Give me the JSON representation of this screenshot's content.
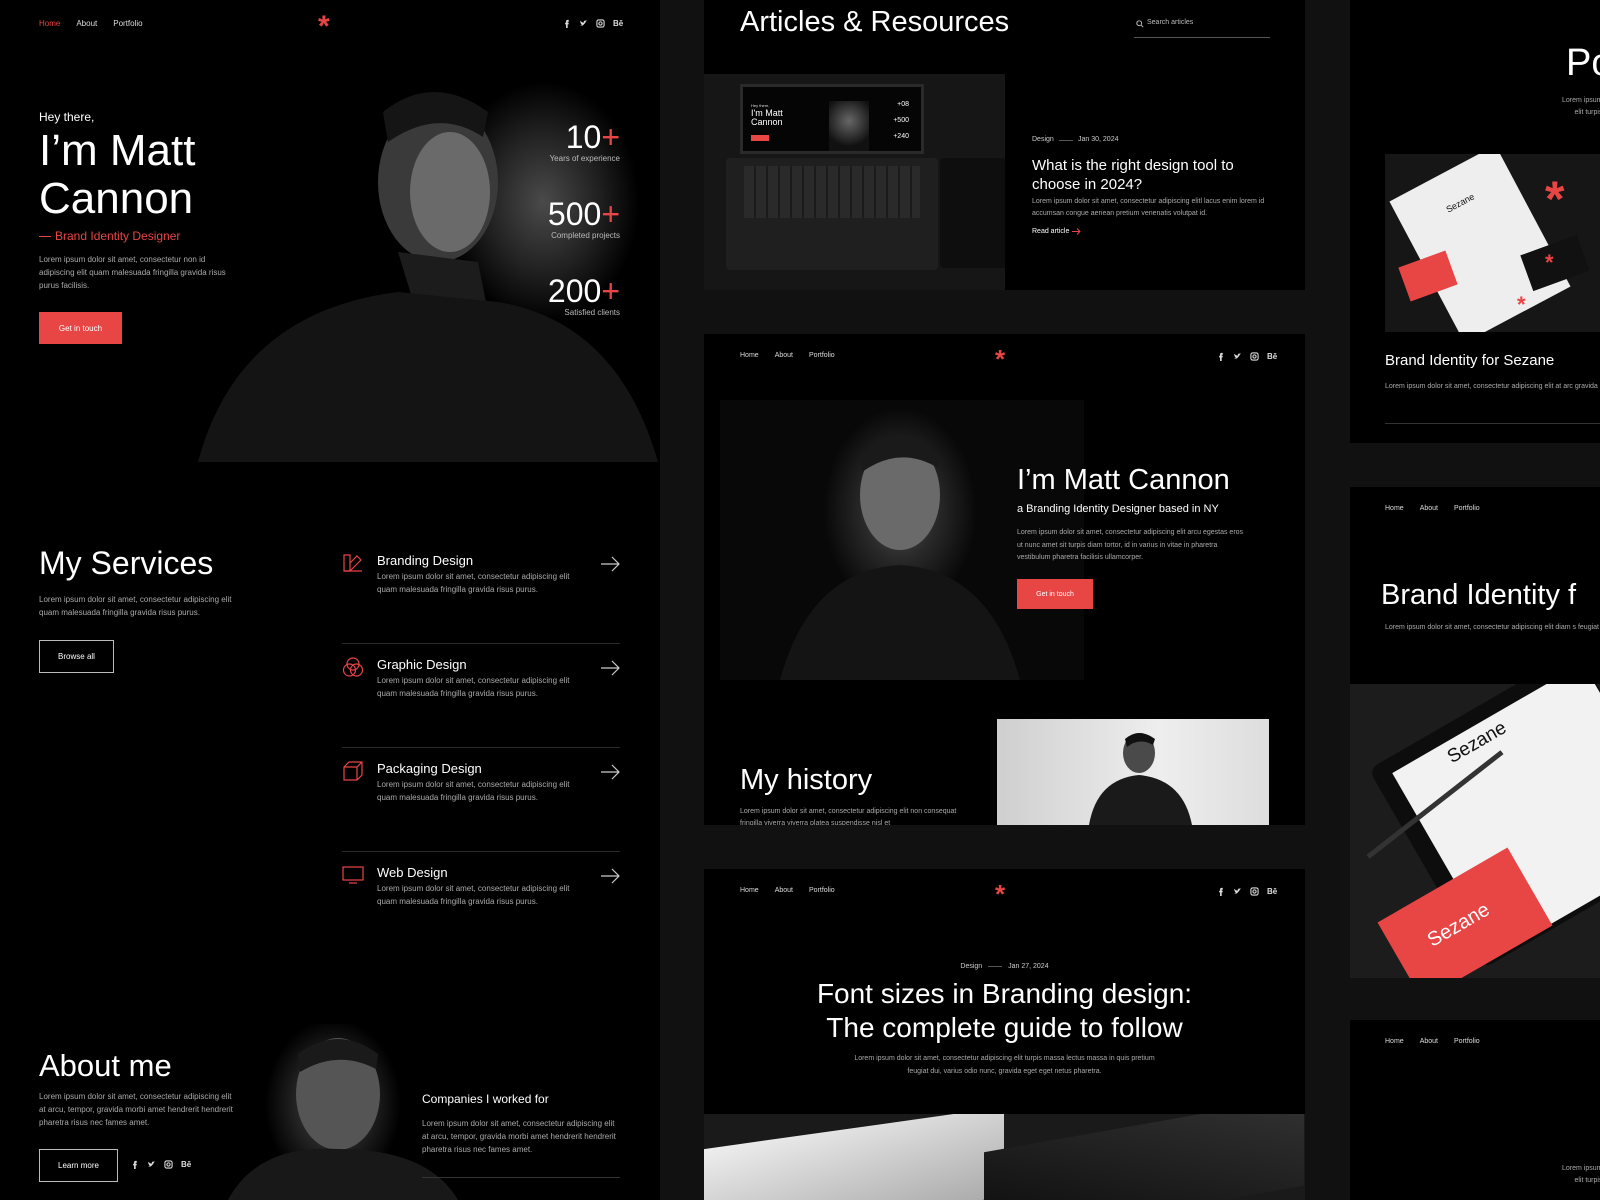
{
  "colors": {
    "accent": "#e84545",
    "background": "#000000",
    "canvas": "#111111"
  },
  "home": {
    "nav": [
      "Home",
      "About",
      "Portfolio"
    ],
    "logo": "*",
    "social": [
      "facebook-icon",
      "twitter-icon",
      "instagram-icon",
      "behance-icon"
    ],
    "social_behance": "Bē",
    "greeting": "Hey there,",
    "name_line1": "I’m Matt",
    "name_line2": "Cannon",
    "role": "Brand Identity Designer",
    "intro": "Lorem ipsum dolor sit amet, consectetur non id adipiscing elit quam malesuada fringilla gravida risus purus facilisis.",
    "cta": "Get in touch",
    "stats": [
      {
        "num": "10",
        "plus": "+",
        "label": "Years of experience"
      },
      {
        "num": "500",
        "plus": "+",
        "label": "Completed projects"
      },
      {
        "num": "200",
        "plus": "+",
        "label": "Satisfied clients"
      }
    ],
    "services_title": "My Services",
    "services_intro": "Lorem ipsum dolor sit amet, consectetur adipiscing elit quam malesuada fringilla gravida risus purus.",
    "browse": "Browse all",
    "services": [
      {
        "title": "Branding Design",
        "desc": "Lorem ipsum dolor sit amet, consectetur adipiscing elit quam malesuada fringilla gravida risus purus."
      },
      {
        "title": "Graphic Design",
        "desc": "Lorem ipsum dolor sit amet, consectetur adipiscing elit quam malesuada fringilla gravida risus purus."
      },
      {
        "title": "Packaging Design",
        "desc": "Lorem ipsum dolor sit amet, consectetur adipiscing elit quam malesuada fringilla gravida risus purus."
      },
      {
        "title": "Web Design",
        "desc": "Lorem ipsum dolor sit amet, consectetur adipiscing elit quam malesuada fringilla gravida risus purus."
      }
    ],
    "about_title": "About me",
    "about_text": "Lorem ipsum dolor sit amet, consectetur adipiscing elit at arcu, tempor, gravida morbi amet hendrerit hendrerit pharetra risus nec fames amet.",
    "learn": "Learn more",
    "companies_title": "Companies I worked for",
    "companies_text": "Lorem ipsum dolor sit amet, consectetur adipiscing elit at arcu, tempor, gravida morbi amet hendrerit hendrerit pharetra risus nec fames amet."
  },
  "articles": {
    "title": "Articles & Resources",
    "search_placeholder": "Search articles",
    "tag": "Design",
    "date": "Jan 30, 2024",
    "headline": "What is the right design tool to choose in 2024?",
    "excerpt": "Lorem ipsum dolor sit amet, consectetur adipiscing elitl lacus enim lorem id accumsan congue aenean pretium venenatis volutpat id.",
    "read": "Read article",
    "mock_name": "I'm Matt Cannon",
    "mock_greeting": "Hey there,",
    "mock_stats": [
      "+08",
      "+500",
      "+240"
    ]
  },
  "about_page": {
    "nav": [
      "Home",
      "About",
      "Portfolio"
    ],
    "name": "I’m Matt Cannon",
    "subtitle": "a Branding Identity Designer based in NY",
    "text": "Lorem ipsum dolor sit amet, consectetur adipiscing elit arcu egestas eros ut nunc amet sit turpis diam tortor, id in varius in vitae in pharetra vestibulum pharetra facilisis ullamcorper.",
    "cta": "Get in touch",
    "history_title": "My history",
    "history_text": "Lorem ipsum dolor sit amet, consectetur adipiscing elit non consequat fringilla viverra viverra platea suspendisse nisl et"
  },
  "article_page": {
    "nav": [
      "Home",
      "About",
      "Portfolio"
    ],
    "tag": "Design",
    "date": "Jan 27, 2024",
    "title_line1": "Font sizes in Branding design:",
    "title_line2": "The complete guide to follow",
    "text": "Lorem ipsum dolor sit amet, consectetur adipiscing elit turpis massa lectus massa in quis pretium feugiat dui, varius odio nunc, gravida eget eget netus pharetra."
  },
  "portfolio": {
    "title_partial": "Po",
    "text_partial": "Lorem ipsum\nelit turpis",
    "card_title": "Brand Identity for Sezane",
    "card_text": "Lorem ipsum dolor sit amet, consectetur adipiscing elit at arc gravida morbi amet hendrerit hendrerit non pharetra risus nec",
    "brand": "Sezane",
    "nav": [
      "Home",
      "About",
      "Portfolio"
    ],
    "case_title": "Brand Identity f",
    "case_text": "Lorem ipsum dolor sit amet, consectetur adipiscing elit diam s feugiat donec et orci sed libero eu egestas tristique in bibend",
    "bottom_text": "Lorem ipsum\nelit turpis"
  }
}
